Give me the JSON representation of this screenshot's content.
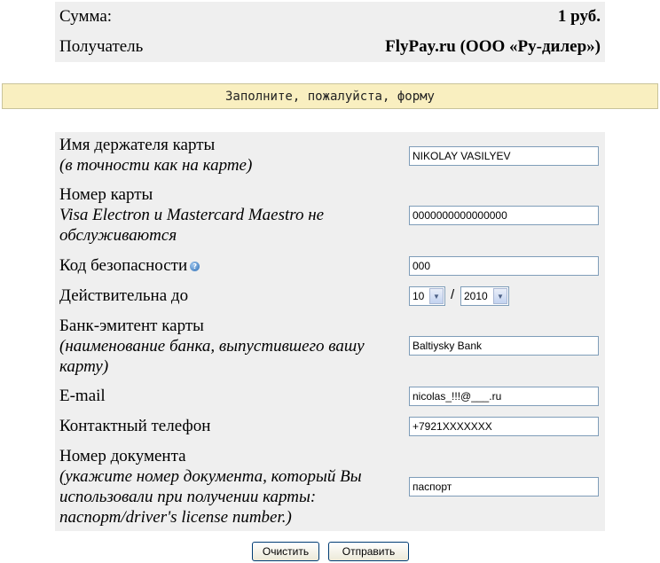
{
  "summary": {
    "amount_label": "Сумма:",
    "amount_value": "1 руб.",
    "recipient_label": "Получатель",
    "recipient_value": "FlyPay.ru (ООО «Ру-дилер»)"
  },
  "notice": "Заполните, пожалуйста, форму",
  "form": {
    "cardholder": {
      "label": "Имя держателя карты",
      "hint": "(в точности как на карте)",
      "value": "NIKOLAY VASILYEV"
    },
    "card_number": {
      "label": "Номер карты",
      "hint_line1": "Visa Electron и Mastercard Maestro не",
      "hint_line2": "обслуживаются",
      "value": "0000000000000000"
    },
    "security_code": {
      "label": "Код безопасности",
      "help_icon": "help-icon",
      "value": "000"
    },
    "valid_until": {
      "label": "Действительна до",
      "month": "10",
      "separator": "/",
      "year": "2010"
    },
    "issuer_bank": {
      "label": "Банк-эмитент карты",
      "hint_line1": "(наименование банка, выпустившего вашу",
      "hint_line2": "карту)",
      "value": "Baltiysky Bank"
    },
    "email": {
      "label": "E-mail",
      "value": "nicolas_!!!@___.ru"
    },
    "phone": {
      "label": "Контактный телефон",
      "value": "+7921XXXXXXX"
    },
    "document": {
      "label": "Номер документа",
      "hint_line1": "(укажите номер документа, который Вы",
      "hint_line2": "использовали при получении карты:",
      "hint_line3": "паспорт/driver's license number.)",
      "value": "паспорт"
    }
  },
  "buttons": {
    "clear": "Очистить",
    "submit": "Отправить"
  }
}
